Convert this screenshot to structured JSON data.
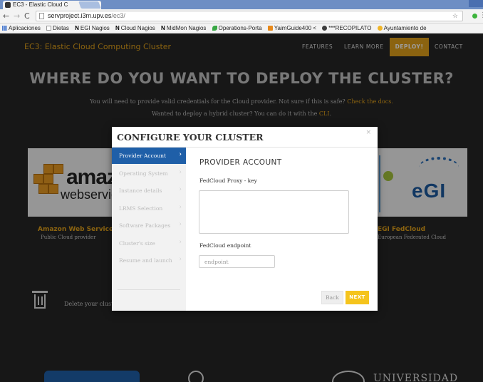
{
  "browser": {
    "tab_title": "EC3 - Elastic Cloud C",
    "tab_close": "×",
    "url_host": "servproject.i3m.upv.es",
    "url_path": "/ec3/",
    "omni_right_icons": "☆",
    "bookmarks": [
      {
        "label": "Aplicaciones",
        "icon": "apps-icon"
      },
      {
        "label": "Dietas",
        "icon": "doc-icon"
      },
      {
        "label": "EGI Nagios",
        "icon": "nagios-icon"
      },
      {
        "label": "Cloud Nagios",
        "icon": "nagios-icon"
      },
      {
        "label": "MidMon Nagios",
        "icon": "nagios-icon"
      },
      {
        "label": "Operations-Porta",
        "icon": "leaf-icon"
      },
      {
        "label": "YaimGuide400 <",
        "icon": "orange-icon"
      },
      {
        "label": "***RECOPILATO",
        "icon": "globe-icon"
      },
      {
        "label": "Ayuntamiento de",
        "icon": "yellow-icon"
      }
    ]
  },
  "site": {
    "brand": "EC3: Elastic Cloud Computing Cluster",
    "nav": {
      "features": "FEATURES",
      "learn_more": "LEARN MORE",
      "deploy": "DEPLOY!",
      "contact": "CONTACT"
    },
    "hero_title": "WHERE DO YOU WANT TO DEPLOY THE CLUSTER?",
    "hero_line1_text": "You will need to provide valid credentials for the Cloud provider. Not sure if this is safe?",
    "hero_line1_link": "Check the docs.",
    "hero_line2_text": "Wanted to deploy a hybrid cluster? You can do it with the",
    "hero_line2_link": "CLI",
    "hero_line2_end": ".",
    "providers": [
      {
        "logo_word": "amazo",
        "logo_sub": "webservic",
        "label": "Amazon Web Service",
        "sub": "Public Cloud provider"
      },
      {
        "logo_word": "eGI",
        "label": "EGI FedCloud",
        "sub": "European Federated Cloud"
      }
    ],
    "delete_text": "Delete your cluster",
    "footer_univ": "UNIVERSIDAD"
  },
  "modal": {
    "title": "CONFIGURE YOUR CLUSTER",
    "close": "×",
    "steps": [
      {
        "label": "Provider Account",
        "active": true
      },
      {
        "label": "Operating System",
        "active": false
      },
      {
        "label": "Instance details",
        "active": false
      },
      {
        "label": "LRMS Selection",
        "active": false
      },
      {
        "label": "Software Packages",
        "active": false
      },
      {
        "label": "Cluster's size",
        "active": false
      },
      {
        "label": "Resume and launch",
        "active": false
      }
    ],
    "step_chevron": "›",
    "panel_title": "PROVIDER ACCOUNT",
    "proxy_label": "FedCloud Proxy - key",
    "proxy_value": "",
    "endpoint_label": "FedCloud endpoint",
    "endpoint_placeholder": "endpoint",
    "endpoint_value": "",
    "back_label": "Back",
    "next_label": "NEXT"
  },
  "colors": {
    "accent": "#e0a11a",
    "primary_blue": "#1f5fa8",
    "next_yellow": "#f5c41d",
    "page_bg": "#262626"
  }
}
